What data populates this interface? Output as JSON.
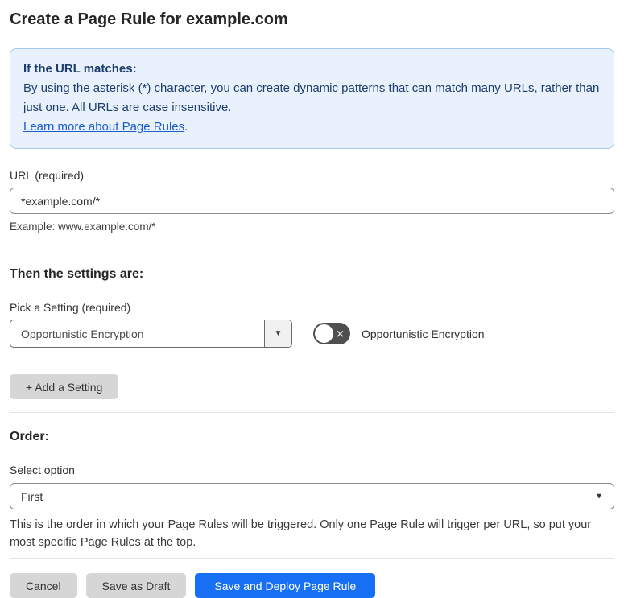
{
  "page": {
    "title": "Create a Page Rule for example.com"
  },
  "info_box": {
    "heading": "If the URL matches:",
    "body": "By using the asterisk (*) character, you can create dynamic patterns that can match many URLs, rather than just one. All URLs are case insensitive.",
    "link_label": "Learn more about Page Rules",
    "link_suffix": "."
  },
  "url_field": {
    "label": "URL (required)",
    "value": "*example.com/*",
    "example": "Example: www.example.com/*"
  },
  "settings_section": {
    "heading": "Then the settings are:",
    "picker_label": "Pick a Setting (required)",
    "selected_setting": "Opportunistic Encryption",
    "dropdown_caret": "▼",
    "toggle_state": "off",
    "toggle_icon": "✕",
    "toggle_label": "Opportunistic Encryption",
    "add_setting_button": "+ Add a Setting"
  },
  "order_section": {
    "heading": "Order:",
    "select_label": "Select option",
    "selected_option": "First",
    "dropdown_caret": "▼",
    "help_text": "This is the order in which your Page Rules will be triggered. Only one Page Rule will trigger per URL, so put your most specific Page Rules at the top."
  },
  "footer": {
    "cancel_label": "Cancel",
    "save_draft_label": "Save as Draft",
    "save_deploy_label": "Save and Deploy Page Rule"
  },
  "colors": {
    "info_bg": "#e9f2fc",
    "info_border": "#a5c9ee",
    "info_text": "#1d3d6d",
    "link_blue": "#1a5dc8",
    "primary_button_blue": "#176ff3",
    "gray_button": "#d6d6d6",
    "toggle_off_gray": "#4f4f4f"
  }
}
